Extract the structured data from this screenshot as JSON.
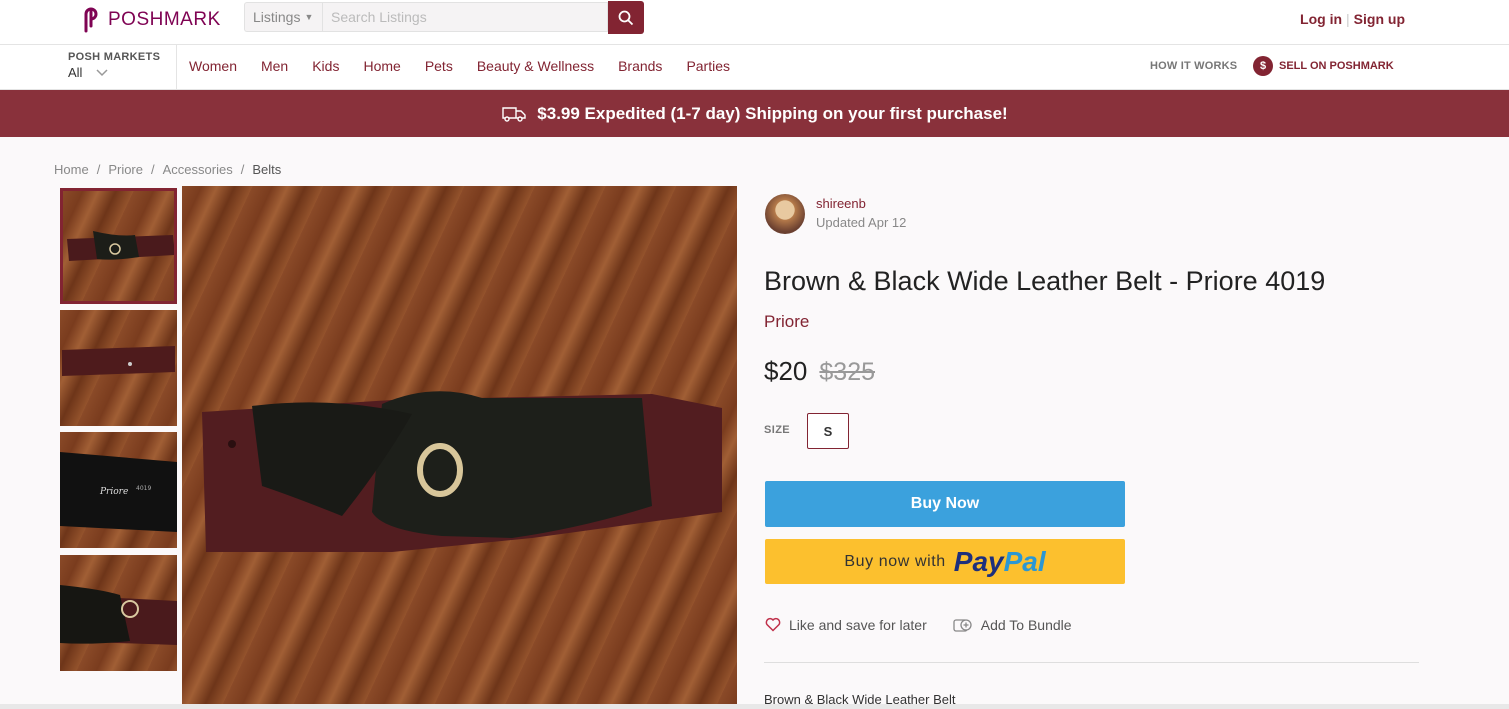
{
  "brand_logo": "POSHMARK",
  "search": {
    "category": "Listings",
    "placeholder": "Search Listings"
  },
  "auth": {
    "login": "Log in",
    "separator": "|",
    "signup": "Sign up"
  },
  "markets": {
    "label": "POSH MARKETS",
    "value": "All"
  },
  "nav": [
    "Women",
    "Men",
    "Kids",
    "Home",
    "Pets",
    "Beauty & Wellness",
    "Brands",
    "Parties"
  ],
  "how_it_works": "HOW IT WORKS",
  "sell": "SELL ON POSHMARK",
  "sell_icon_glyph": "$",
  "banner": "$3.99 Expedited (1-7 day) Shipping on your first purchase!",
  "breadcrumb": [
    "Home",
    "Priore",
    "Accessories",
    "Belts"
  ],
  "breadcrumb_sep": "/",
  "listing": {
    "seller": "shireenb",
    "updated": "Updated Apr 12",
    "title": "Brown & Black Wide Leather Belt - Priore 4019",
    "brand": "Priore",
    "price": "$20",
    "original_price": "$325",
    "size_label": "SIZE",
    "size": "S",
    "buy_now": "Buy Now",
    "paypal_prefix": "Buy now with",
    "paypal_brand_1": "Pay",
    "paypal_brand_2": "Pal",
    "like": "Like and save for later",
    "bundle": "Add To Bundle",
    "description": "Brown & Black Wide Leather Belt"
  },
  "colors": {
    "brand": "#822432",
    "banner": "#89313b",
    "buy_now": "#3ba1dd",
    "paypal": "#fcc02e"
  }
}
